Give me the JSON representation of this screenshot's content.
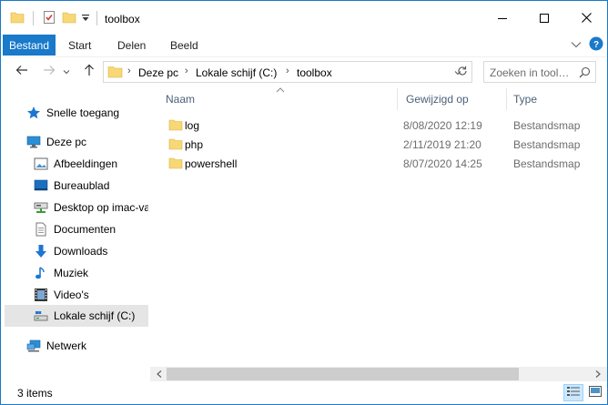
{
  "window": {
    "title": "toolbox",
    "controls": [
      "minimize-icon",
      "maximize-icon",
      "close-icon"
    ]
  },
  "ribbon": {
    "file_tab": "Bestand",
    "tabs": [
      "Start",
      "Delen",
      "Beeld"
    ]
  },
  "address": {
    "crumbs": [
      "Deze pc",
      "Lokale schijf (C:)",
      "toolbox"
    ],
    "search_placeholder": "Zoeken in tool…"
  },
  "nav": {
    "quick_access": "Snelle toegang",
    "this_pc": "Deze pc",
    "items": [
      {
        "label": "Afbeeldingen",
        "icon": "pictures-icon"
      },
      {
        "label": "Bureaublad",
        "icon": "desktop-icon"
      },
      {
        "label": "Desktop op imac-va",
        "icon": "network-drive-icon"
      },
      {
        "label": "Documenten",
        "icon": "documents-icon"
      },
      {
        "label": "Downloads",
        "icon": "downloads-icon"
      },
      {
        "label": "Muziek",
        "icon": "music-icon"
      },
      {
        "label": "Video's",
        "icon": "videos-icon"
      },
      {
        "label": "Lokale schijf (C:)",
        "icon": "drive-icon",
        "selected": true
      }
    ],
    "network": "Netwerk"
  },
  "columns": {
    "name": "Naam",
    "modified": "Gewijzigd op",
    "type": "Type"
  },
  "files": [
    {
      "name": "log",
      "modified": "8/08/2020 12:19",
      "type": "Bestandsmap"
    },
    {
      "name": "php",
      "modified": "2/11/2019 21:20",
      "type": "Bestandsmap"
    },
    {
      "name": "powershell",
      "modified": "8/07/2020 14:25",
      "type": "Bestandsmap"
    }
  ],
  "status": {
    "item_count": "3 items"
  },
  "colors": {
    "accent": "#1979ca",
    "folder": "#f8d775",
    "header_text": "#4c607a",
    "selected_bg": "#e5e5e5"
  }
}
